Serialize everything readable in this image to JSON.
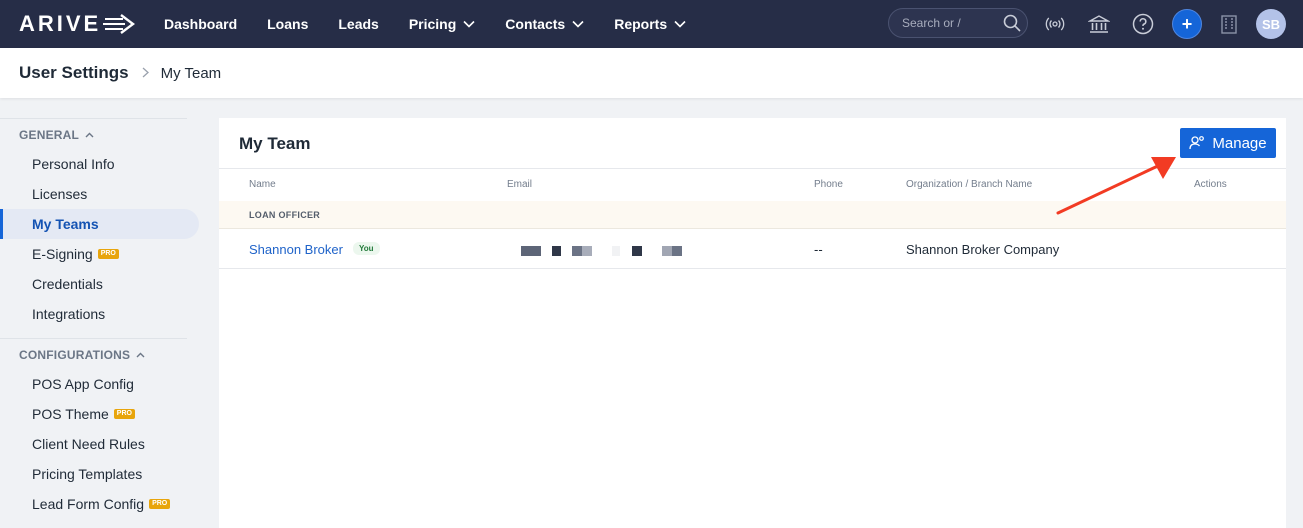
{
  "brand": {
    "logo_text": "ARIVE"
  },
  "topnav": {
    "items": [
      {
        "label": "Dashboard",
        "has_dropdown": false
      },
      {
        "label": "Loans",
        "has_dropdown": false
      },
      {
        "label": "Leads",
        "has_dropdown": false
      },
      {
        "label": "Pricing",
        "has_dropdown": true
      },
      {
        "label": "Contacts",
        "has_dropdown": true
      },
      {
        "label": "Reports",
        "has_dropdown": true
      }
    ],
    "search_placeholder": "Search or /",
    "icons": [
      "broadcast-icon",
      "bank-icon",
      "help-icon",
      "plus-icon",
      "building-icon"
    ],
    "plus_label": "+",
    "avatar_initials": "SB"
  },
  "breadcrumb": {
    "root": "User Settings",
    "separator": ">",
    "current": "My Team"
  },
  "sidebar": {
    "general_label": "GENERAL",
    "general_items": [
      {
        "label": "Personal Info",
        "pro": false,
        "active": false
      },
      {
        "label": "Licenses",
        "pro": false,
        "active": false
      },
      {
        "label": "My Teams",
        "pro": false,
        "active": true
      },
      {
        "label": "E-Signing",
        "pro": true,
        "active": false
      },
      {
        "label": "Credentials",
        "pro": false,
        "active": false
      },
      {
        "label": "Integrations",
        "pro": false,
        "active": false
      }
    ],
    "config_label": "CONFIGURATIONS",
    "config_items": [
      {
        "label": "POS App Config",
        "pro": false
      },
      {
        "label": "POS Theme",
        "pro": true
      },
      {
        "label": "Client Need Rules",
        "pro": false
      },
      {
        "label": "Pricing Templates",
        "pro": false
      },
      {
        "label": "Lead Form Config",
        "pro": true
      }
    ],
    "pro_label": "PRO"
  },
  "main": {
    "title": "My Team",
    "manage_label": "Manage",
    "columns": [
      "Name",
      "Email",
      "Phone",
      "Organization / Branch Name",
      "Actions"
    ],
    "group_label": "LOAN OFFICER",
    "rows": [
      {
        "name": "Shannon Broker",
        "badge": "You",
        "phone": "--",
        "organization": "Shannon Broker Company"
      }
    ]
  },
  "colors": {
    "topbar": "#262d47",
    "accent": "#1565d8",
    "annotation_arrow": "#f23b23",
    "pro_badge": "#e8a50c"
  }
}
